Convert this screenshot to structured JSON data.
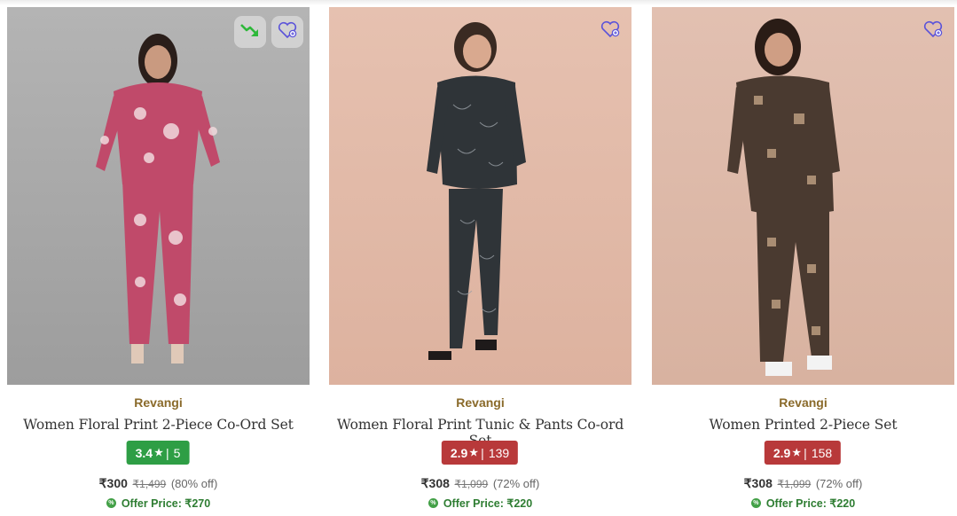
{
  "products": [
    {
      "brand": "Revangi",
      "name": "Women Floral Print 2-Piece Co-Ord Set",
      "rating": "3.4",
      "rating_count": "5",
      "rating_color": "#2e9e45",
      "price": "₹300",
      "mrp": "₹1,499",
      "discount": "(80% off)",
      "offer_label": "Offer Price: ₹270",
      "bg_color": "#a9a9a9",
      "outfit_color": "#c04a6a",
      "icons": [
        "price-drop-icon",
        "wishlist-heart-icon"
      ]
    },
    {
      "brand": "Revangi",
      "name": "Women Floral Print Tunic & Pants Co-ord Set",
      "rating": "2.9",
      "rating_count": "139",
      "rating_color": "#b8393a",
      "price": "₹308",
      "mrp": "₹1,099",
      "discount": "(72% off)",
      "offer_label": "Offer Price: ₹220",
      "bg_color": "#e2b9a6",
      "outfit_color": "#2f3438",
      "icons": [
        "wishlist-heart-icon"
      ]
    },
    {
      "brand": "Revangi",
      "name": "Women Printed 2-Piece Set",
      "rating": "2.9",
      "rating_count": "158",
      "rating_color": "#b8393a",
      "price": "₹308",
      "mrp": "₹1,099",
      "discount": "(72% off)",
      "offer_label": "Offer Price: ₹220",
      "bg_color": "#deb9a8",
      "outfit_color": "#4a3a30",
      "icons": [
        "wishlist-heart-icon"
      ]
    }
  ],
  "rating_star": "★",
  "rating_sep": "|",
  "offer_badge": "%"
}
